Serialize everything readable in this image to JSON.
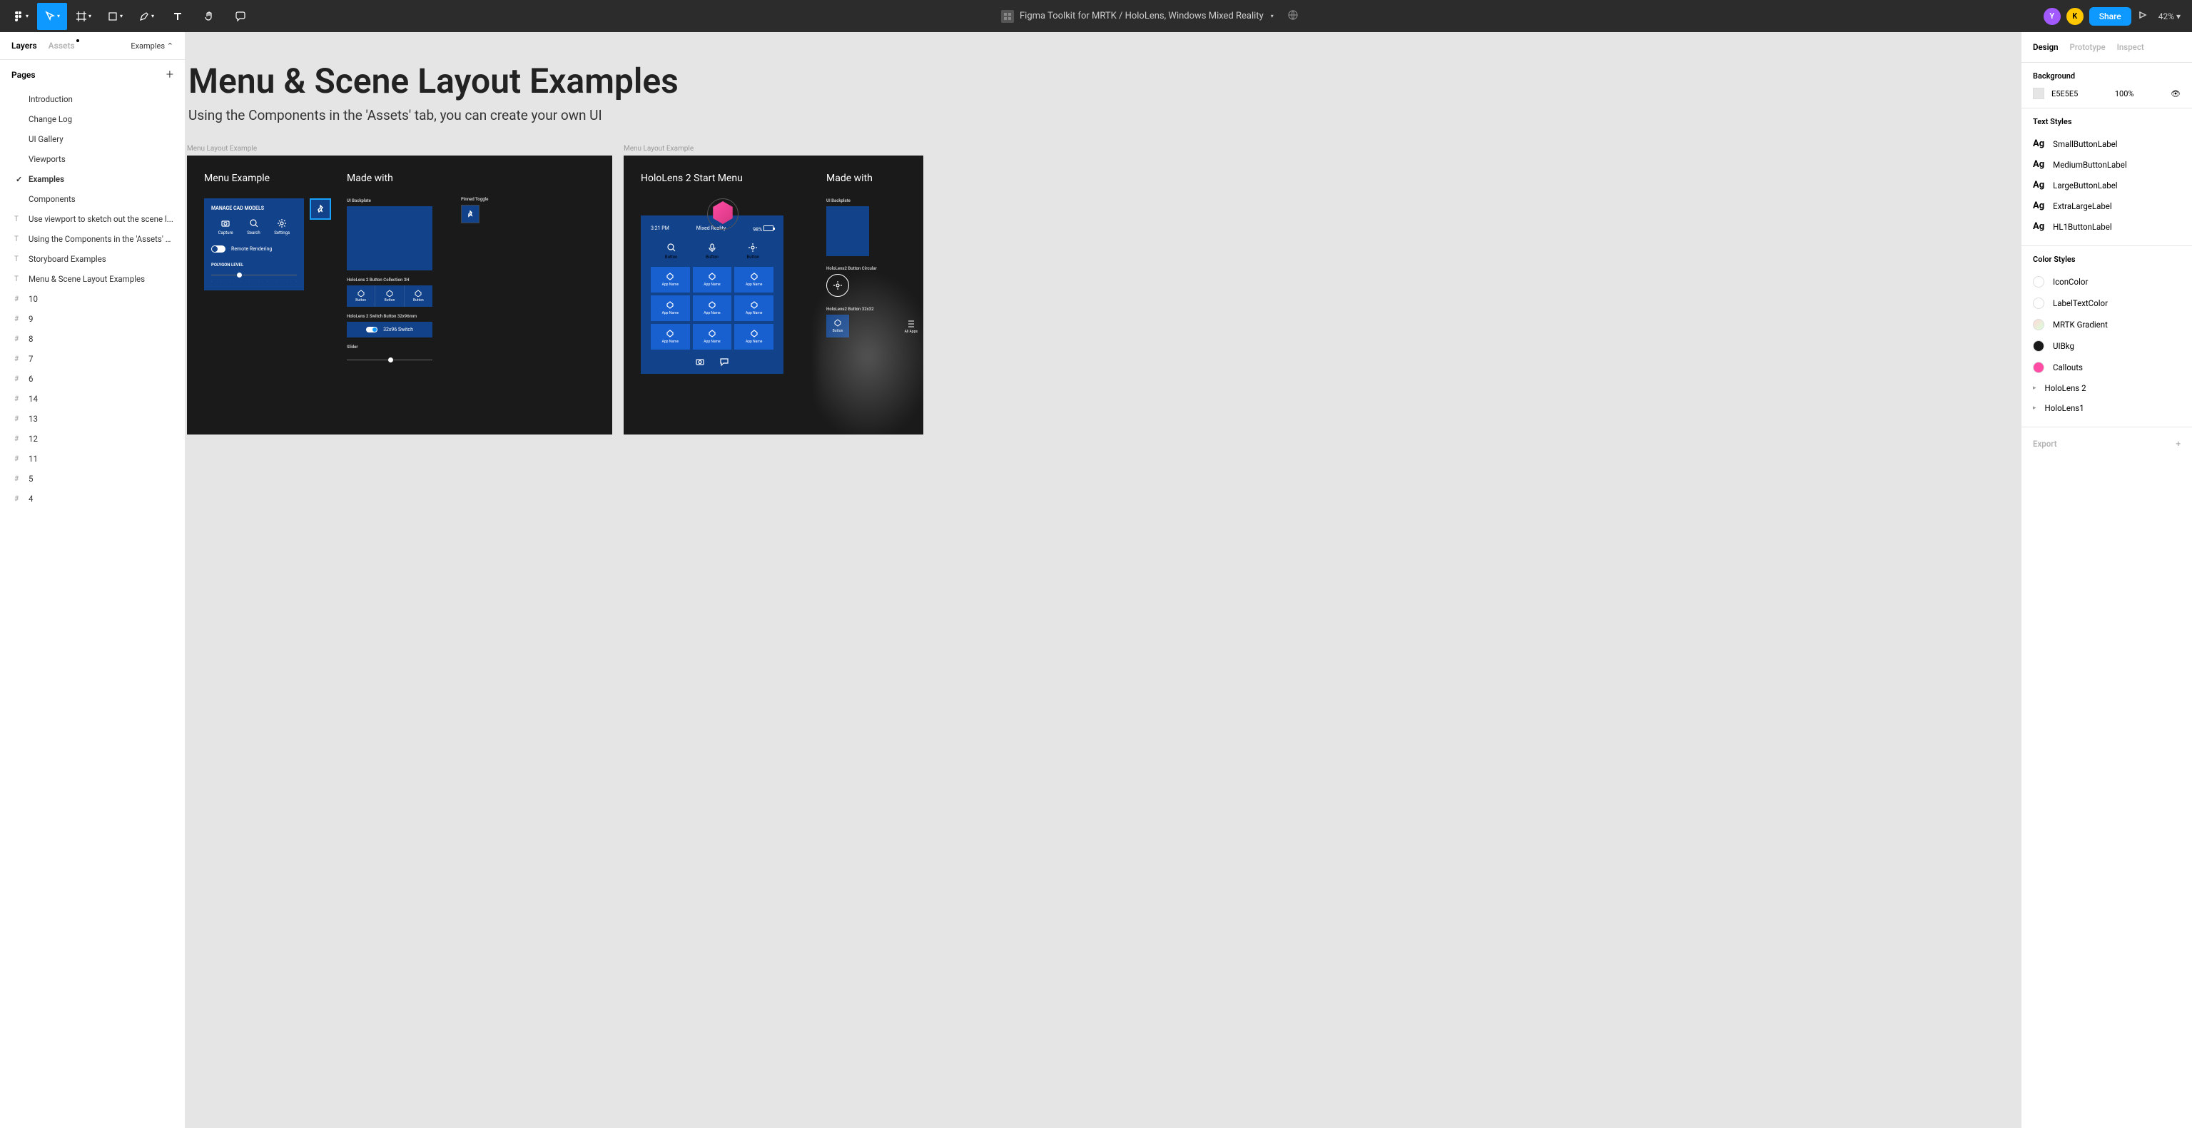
{
  "toolbar": {
    "title": "Figma Toolkit for MRTK / HoloLens, Windows Mixed Reality",
    "share": "Share",
    "zoom": "42%",
    "avatars": [
      {
        "letter": "Y",
        "bg": "#a259ff"
      },
      {
        "letter": "K",
        "bg": "#ffc700"
      }
    ]
  },
  "leftPanel": {
    "tabs": {
      "layers": "Layers",
      "assets": "Assets"
    },
    "examplesSel": "Examples",
    "pagesLabel": "Pages",
    "pages": [
      "Introduction",
      "Change Log",
      "UI Gallery",
      "Viewports",
      "Examples",
      "Components"
    ],
    "activePage": "Examples",
    "layers": [
      {
        "icon": "T",
        "label": "Use viewport to sketch out the scene l..."
      },
      {
        "icon": "T",
        "label": "Using the Components in the 'Assets' t..."
      },
      {
        "icon": "T",
        "label": "Storyboard Examples"
      },
      {
        "icon": "T",
        "label": "Menu & Scene Layout Examples"
      },
      {
        "icon": "#",
        "label": "10"
      },
      {
        "icon": "#",
        "label": "9"
      },
      {
        "icon": "#",
        "label": "8"
      },
      {
        "icon": "#",
        "label": "7"
      },
      {
        "icon": "#",
        "label": "6"
      },
      {
        "icon": "#",
        "label": "14"
      },
      {
        "icon": "#",
        "label": "13"
      },
      {
        "icon": "#",
        "label": "12"
      },
      {
        "icon": "#",
        "label": "11"
      },
      {
        "icon": "#",
        "label": "5"
      },
      {
        "icon": "#",
        "label": "4"
      }
    ]
  },
  "canvas": {
    "title": "Menu & Scene Layout Examples",
    "subtitle": "Using the Components in the 'Assets' tab, you can create your own UI",
    "frame1Label": "Menu Layout Example",
    "frame2Label": "Menu Layout Example",
    "menuExample": "Menu Example",
    "madeWith": "Made with",
    "manageCad": "MANAGE CAD MODELS",
    "capture": "Capture",
    "search": "Search",
    "settings": "Settings",
    "remoteRendering": "Remote Rendering",
    "polygonLevel": "POLYGON LEVEL",
    "uiBackplate": "UI Backplate",
    "pinnedToggle": "Pinned Toggle",
    "btnCollection": "HoloLens 2 Button Collection 3H",
    "button": "Button",
    "switchBtn": "HoloLens 2 Switch Button 32x96mm",
    "switchLabel": "32x96 Switch",
    "sliderLabel": "Slider",
    "holoStart": "HoloLens 2 Start Menu",
    "time": "3:21 PM",
    "mixedReality": "Mixed Reality",
    "battery": "98%",
    "appName": "App Name",
    "allApps": "All Apps",
    "circleBtn": "HoloLens2 Button Circular",
    "sqBtn": "HoloLens2 Button 32x32"
  },
  "rightPanel": {
    "tabs": {
      "design": "Design",
      "prototype": "Prototype",
      "inspect": "Inspect"
    },
    "background": "Background",
    "bgHex": "E5E5E5",
    "bgOpacity": "100%",
    "textStyles": "Text Styles",
    "textStyleList": [
      "SmallButtonLabel",
      "MediumButtonLabel",
      "LargeButtonLabel",
      "ExtraLargeLabel",
      "HL1ButtonLabel"
    ],
    "colorStyles": "Color Styles",
    "colors": [
      {
        "name": "IconColor",
        "color": "#ffffff"
      },
      {
        "name": "LabelTextColor",
        "color": "#ffffff"
      },
      {
        "name": "MRTK Gradient",
        "color": "linear-gradient(135deg,#ffd9d9,#d9ffd9)"
      },
      {
        "name": "UIBkg",
        "color": "#1a1a1a"
      },
      {
        "name": "Callouts",
        "color": "#ff4da6"
      }
    ],
    "colorGroups": [
      "HoloLens 2",
      "HoloLens1"
    ],
    "export": "Export"
  }
}
